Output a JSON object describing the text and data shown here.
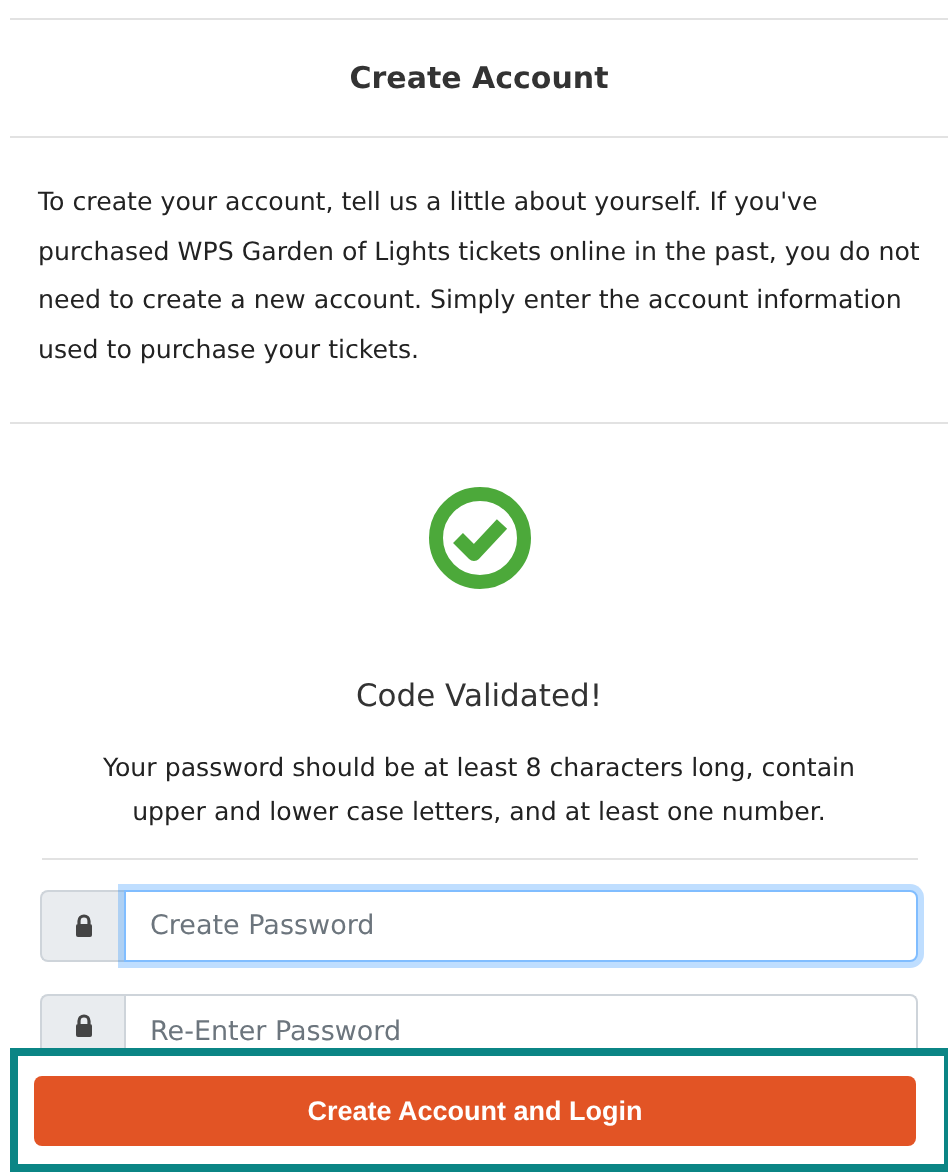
{
  "header": {
    "title": "Create Account"
  },
  "intro": "To create your account, tell us a little about yourself. If you've purchased WPS Garden of Lights tickets online in the past, you do not need to create a new account. Simply enter the account information used to purchase your tickets.",
  "status": {
    "heading": "Code Validated!",
    "hint": "Your password should be at least 8 characters long, contain upper and lower case letters, and at least one number."
  },
  "fields": [
    {
      "placeholder": "Create Password",
      "focused": true
    },
    {
      "placeholder": "Re-Enter Password",
      "focused": false
    }
  ],
  "submit": {
    "label": "Create Account and Login",
    "highlighted": true
  }
}
